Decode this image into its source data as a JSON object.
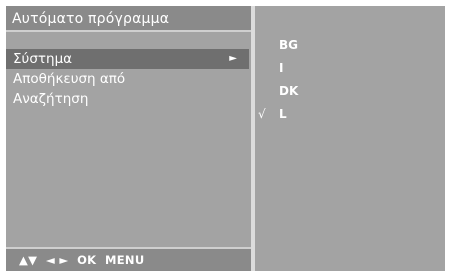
{
  "menu": {
    "title": "Αυτόματο πρόγραμμα",
    "items": [
      {
        "label": "Σύστημα",
        "selected": true,
        "arrow": "►"
      },
      {
        "label": "Αποθήκευση από",
        "selected": false
      },
      {
        "label": "Αναζήτηση",
        "selected": false
      }
    ],
    "nav_hint": "▲▼  ◄ ►  OK  MENU"
  },
  "submenu": {
    "options": [
      {
        "label": "BG",
        "checked": false
      },
      {
        "label": "I",
        "checked": false
      },
      {
        "label": "DK",
        "checked": false
      },
      {
        "label": "L",
        "checked": true,
        "check_mark": "√"
      }
    ]
  },
  "colors": {
    "panel": "#a3a3a3",
    "title_bar": "#8a8a8a",
    "highlight": "#6f6f6f",
    "text": "#ffffff"
  }
}
